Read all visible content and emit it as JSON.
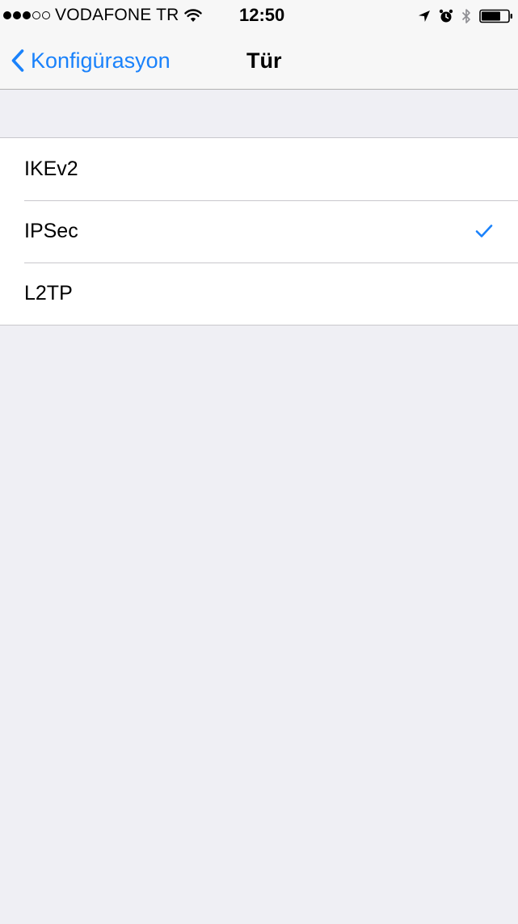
{
  "status_bar": {
    "signal": {
      "filled": 3,
      "total": 5
    },
    "carrier": "VODAFONE TR",
    "time": "12:50",
    "icons": [
      "wifi-icon",
      "location-icon",
      "alarm-icon",
      "bluetooth-icon",
      "battery-icon"
    ]
  },
  "nav": {
    "back_label": "Konfigürasyon",
    "title": "Tür"
  },
  "options": [
    {
      "label": "IKEv2",
      "selected": false
    },
    {
      "label": "IPSec",
      "selected": true
    },
    {
      "label": "L2TP",
      "selected": false
    }
  ],
  "colors": {
    "accent": "#1a82fb",
    "background": "#efeff4",
    "bar": "#f7f7f7",
    "separator": "#c8c7cc"
  }
}
